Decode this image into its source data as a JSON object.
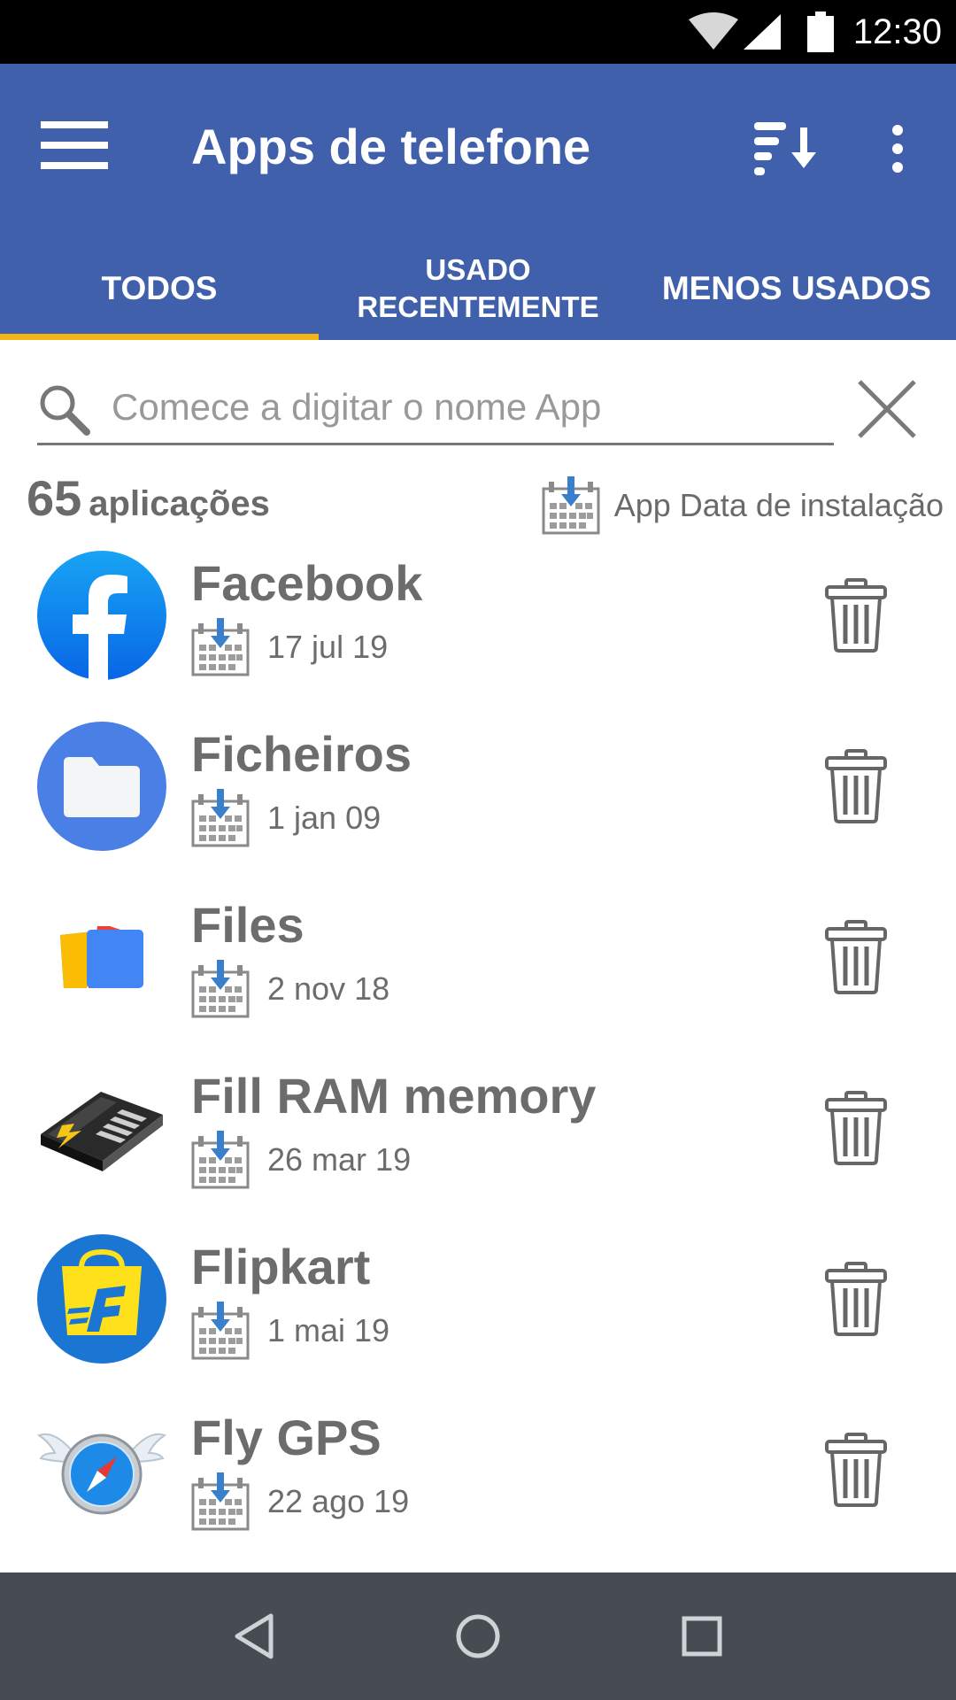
{
  "status_bar": {
    "time": "12:30",
    "icons": [
      "wifi-icon",
      "signal-icon",
      "battery-icon"
    ]
  },
  "app_bar": {
    "title": "Apps de telefone",
    "menu_icon": "menu-icon",
    "sort_icon": "sort-icon",
    "more_icon": "more-vert-icon"
  },
  "tabs": [
    {
      "label": "TODOS",
      "selected": true
    },
    {
      "label": "USADO RECENTEMENTE",
      "selected": false
    },
    {
      "label": "MENOS USADOS",
      "selected": false
    }
  ],
  "search": {
    "placeholder": "Comece a digitar o nome App",
    "value": ""
  },
  "summary": {
    "count": "65",
    "count_label": "aplicações",
    "sort_label": "App Data de instalação"
  },
  "apps": [
    {
      "name": "Facebook",
      "date": "17 jul 19",
      "icon": "facebook-icon"
    },
    {
      "name": "Ficheiros",
      "date": "1 jan 09",
      "icon": "folder-icon"
    },
    {
      "name": "Files",
      "date": "2 nov 18",
      "icon": "files-icon"
    },
    {
      "name": "Fill RAM memory",
      "date": "26 mar 19",
      "icon": "ram-chip-icon"
    },
    {
      "name": "Flipkart",
      "date": "1 mai 19",
      "icon": "flipkart-icon"
    },
    {
      "name": "Fly GPS",
      "date": "22 ago 19",
      "icon": "compass-wings-icon"
    }
  ],
  "colors": {
    "app_bar": "#4160ab",
    "tab_indicator": "#f3b515",
    "text_gray": "#6c6c6c",
    "nav_bar": "#474b52",
    "calendar_arrow": "#3a7fcc"
  },
  "nav_bar": {
    "icons": [
      "back-icon",
      "home-icon",
      "recents-icon"
    ]
  }
}
